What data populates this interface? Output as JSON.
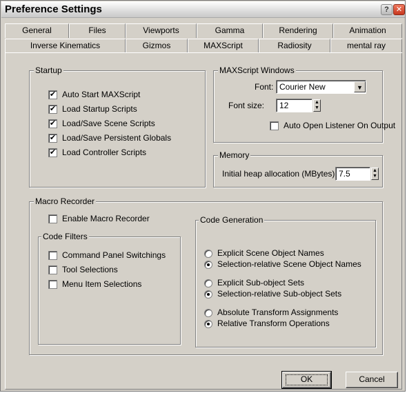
{
  "window": {
    "title": "Preference Settings",
    "help_glyph": "?",
    "close_glyph": "✕"
  },
  "tabs_row1": [
    "General",
    "Files",
    "Viewports",
    "Gamma",
    "Rendering",
    "Animation"
  ],
  "tabs_row2": [
    "Inverse Kinematics",
    "Gizmos",
    "MAXScript",
    "Radiosity",
    "mental ray"
  ],
  "active_tab": "MAXScript",
  "startup": {
    "title": "Startup",
    "items": [
      {
        "label": "Auto Start MAXScript",
        "checked": true
      },
      {
        "label": "Load Startup Scripts",
        "checked": true
      },
      {
        "label": "Load/Save Scene Scripts",
        "checked": true
      },
      {
        "label": "Load/Save Persistent Globals",
        "checked": true
      },
      {
        "label": "Load Controller Scripts",
        "checked": true
      }
    ]
  },
  "maxscript_windows": {
    "title": "MAXScript Windows",
    "font_label": "Font:",
    "font_value": "Courier New",
    "font_size_label": "Font size:",
    "font_size_value": "12",
    "auto_open_label": "Auto Open Listener On Output",
    "auto_open_checked": false
  },
  "memory": {
    "title": "Memory",
    "heap_label": "Initial heap allocation (MBytes):",
    "heap_value": "7.5"
  },
  "macro_recorder": {
    "title": "Macro Recorder",
    "enable_label": "Enable Macro Recorder",
    "enable_checked": false,
    "code_filters": {
      "title": "Code Filters",
      "items": [
        {
          "label": "Command Panel Switchings",
          "checked": false
        },
        {
          "label": "Tool Selections",
          "checked": false
        },
        {
          "label": "Menu Item Selections",
          "checked": false
        }
      ]
    },
    "code_generation": {
      "title": "Code Generation",
      "options": [
        {
          "label": "Explicit Scene Object Names",
          "selected": false
        },
        {
          "label": "Selection-relative Scene Object Names",
          "selected": true
        },
        {
          "label": "Explicit Sub-object Sets",
          "selected": false
        },
        {
          "label": "Selection-relative Sub-object Sets",
          "selected": true
        },
        {
          "label": "Absolute Transform Assignments",
          "selected": false
        },
        {
          "label": "Relative Transform Operations",
          "selected": true
        }
      ]
    }
  },
  "buttons": {
    "ok": "OK",
    "cancel": "Cancel"
  },
  "glyphs": {
    "check": "✔",
    "dropdown": "▼",
    "spin_up": "▲",
    "spin_down": "▼"
  },
  "colors": {
    "face": "#d4d0c8",
    "shadow": "#808080",
    "highlight": "#ffffff",
    "close": "#c8371e"
  }
}
